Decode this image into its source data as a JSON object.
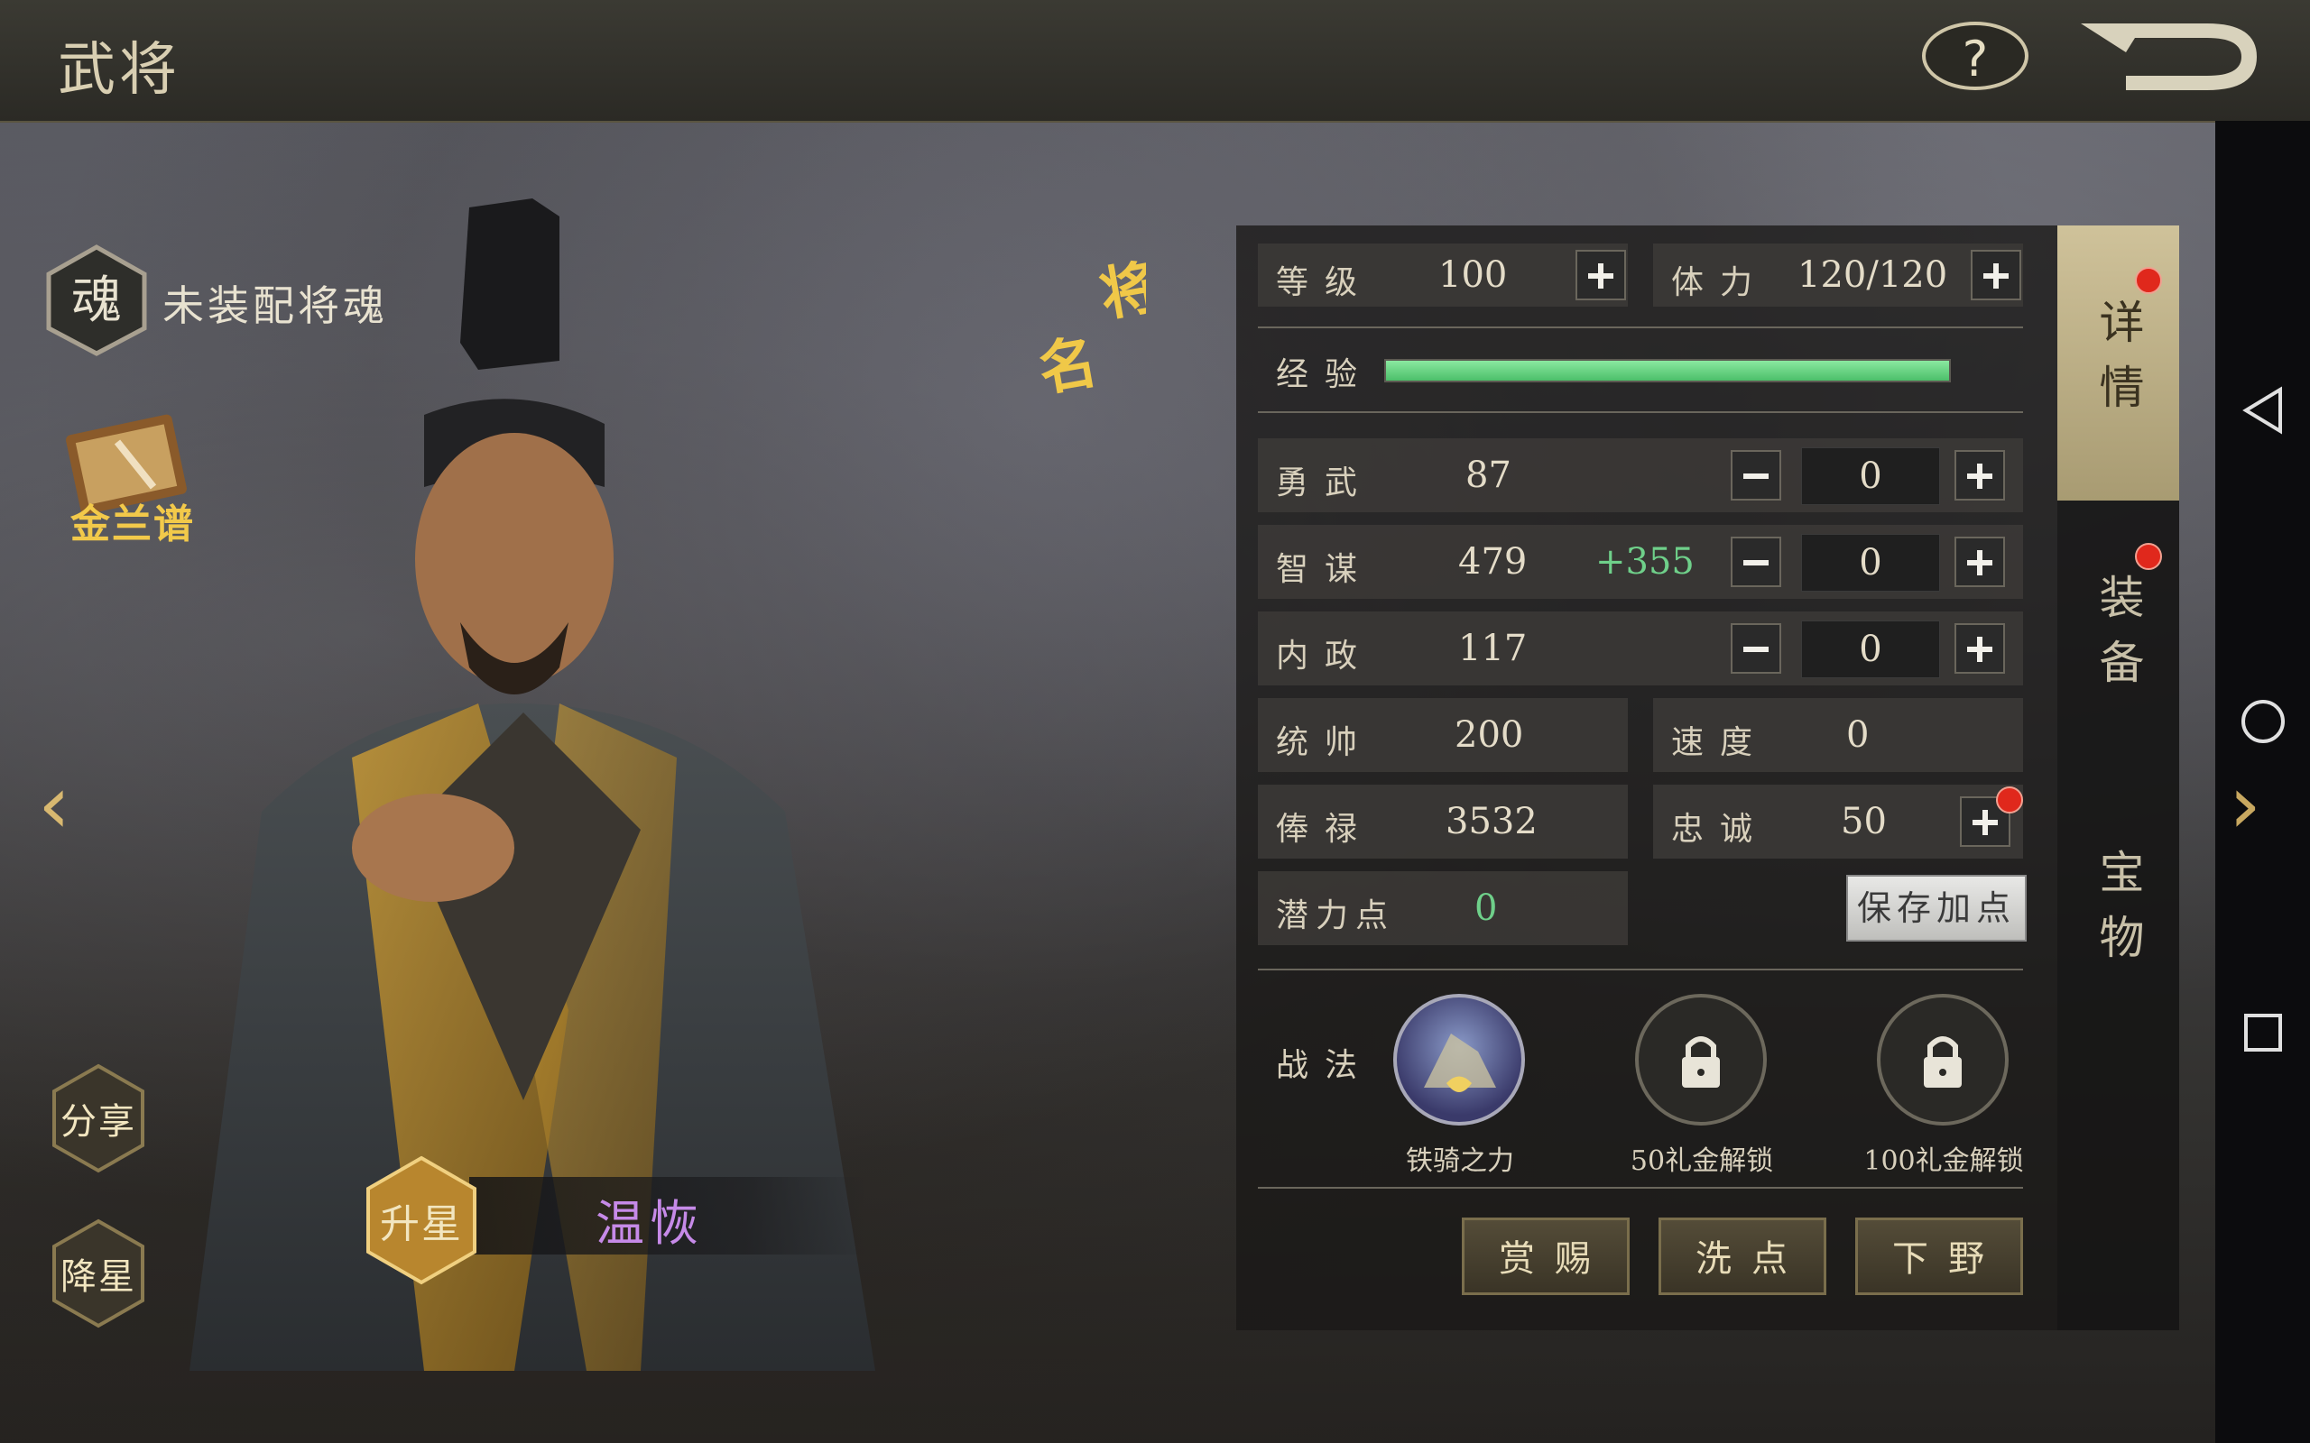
{
  "header": {
    "title": "武将",
    "help_label": "?"
  },
  "left": {
    "soul_icon_char": "魂",
    "soul_text": "未装配将魂",
    "jinlan_label": "金兰谱",
    "share_label": "分享",
    "demote_label": "降星",
    "upgrade_label": "升星",
    "general_name": "温恢",
    "name_badge": "名将"
  },
  "tabs": [
    {
      "label": "详情",
      "active": true,
      "has_dot": true
    },
    {
      "label": "装备",
      "active": false,
      "has_dot": true
    },
    {
      "label": "宝物",
      "active": false,
      "has_dot": false
    }
  ],
  "stats": {
    "level_label": "等级",
    "level": "100",
    "stamina_label": "体力",
    "stamina": "120/120",
    "exp_label": "经验",
    "exp_fraction": 1.0,
    "bravery_label": "勇武",
    "bravery": "87",
    "bravery_add": "0",
    "strategy_label": "智谋",
    "strategy": "479",
    "strategy_bonus": "+355",
    "strategy_add": "0",
    "politics_label": "内政",
    "politics": "117",
    "politics_add": "0",
    "command_label": "统帅",
    "command": "200",
    "speed_label": "速度",
    "speed": "0",
    "salary_label": "俸禄",
    "salary": "3532",
    "loyalty_label": "忠诚",
    "loyalty": "50",
    "potential_label": "潜力点",
    "potential": "0",
    "save_label": "保存加点"
  },
  "skills": {
    "label": "战法",
    "items": [
      {
        "name": "铁骑之力",
        "locked": false
      },
      {
        "name": "50礼金解锁",
        "locked": true
      },
      {
        "name": "100礼金解锁",
        "locked": true
      }
    ]
  },
  "actions": [
    "赏赐",
    "洗点",
    "下野"
  ],
  "colors": {
    "accent_gold": "#d8b870",
    "bonus_green": "#6fd08a",
    "name_purple": "#c68ae8",
    "exp_green": "#4cbf6a"
  }
}
